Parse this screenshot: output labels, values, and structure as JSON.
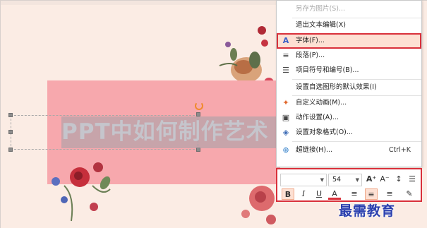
{
  "slide": {
    "art_text": "PPT中如何制作艺术",
    "colors": {
      "background": "#fbece4",
      "rectangle": "#f7a8ad",
      "accent_red": "#d9303a"
    }
  },
  "context_menu": {
    "items": [
      {
        "label": "另存为图片(S)...",
        "icon": "",
        "enabled": false,
        "shortcut": ""
      },
      {
        "label": "退出文本编辑(X)",
        "icon": "",
        "enabled": true,
        "shortcut": ""
      },
      {
        "label": "字体(F)...",
        "icon": "font-a-icon",
        "enabled": true,
        "shortcut": "",
        "highlighted": true
      },
      {
        "label": "段落(P)...",
        "icon": "paragraph-icon",
        "enabled": true,
        "shortcut": ""
      },
      {
        "label": "项目符号和编号(B)...",
        "icon": "bullets-icon",
        "enabled": true,
        "shortcut": ""
      },
      {
        "label": "设置自选图形的默认效果(I)",
        "icon": "",
        "enabled": true,
        "shortcut": ""
      },
      {
        "label": "自定义动画(M)...",
        "icon": "custom-animation-icon",
        "enabled": true,
        "shortcut": ""
      },
      {
        "label": "动作设置(A)...",
        "icon": "action-settings-icon",
        "enabled": true,
        "shortcut": ""
      },
      {
        "label": "设置对象格式(O)...",
        "icon": "format-object-icon",
        "enabled": true,
        "shortcut": ""
      },
      {
        "label": "超链接(H)...",
        "icon": "hyperlink-icon",
        "enabled": true,
        "shortcut": "Ctrl+K"
      }
    ]
  },
  "mini_toolbar": {
    "font_name": "",
    "font_size": "54",
    "grow_font": "A⁺",
    "shrink_font": "A⁻",
    "bold": "B",
    "italic": "I",
    "underline": "U",
    "font_color": "A"
  },
  "watermark": "最需教育"
}
